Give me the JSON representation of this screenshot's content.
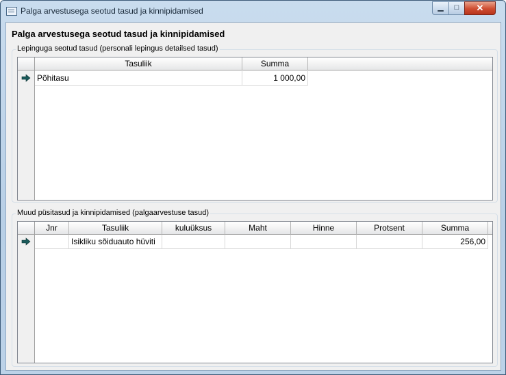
{
  "window": {
    "title": "Palga arvestusega seotud tasud ja kinnipidamised",
    "controls": {
      "minimize": "▁",
      "maximize": "□",
      "close": "✕"
    }
  },
  "heading": "Palga arvestusega seotud tasud ja kinnipidamised",
  "contract_group": {
    "label": "Lepinguga seotud tasud (personali lepingus detailsed tasud)",
    "columns": [
      "Tasuliik",
      "Summa"
    ],
    "rows": [
      {
        "tasuliik": "Põhitasu",
        "summa": "1 000,00"
      }
    ]
  },
  "other_group": {
    "label": "Muud püsitasud ja kinnipidamised (palgaarvestuse tasud)",
    "columns": [
      "Jnr",
      "Tasuliik",
      "kuluüksus",
      "Maht",
      "Hinne",
      "Protsent",
      "Summa"
    ],
    "rows": [
      {
        "jnr": "",
        "tasuliik": "Isikliku sõiduauto hüviti",
        "kuluuksus": "",
        "maht": "",
        "hinne": "",
        "protsent": "",
        "summa": "256,00"
      }
    ]
  },
  "colors": {
    "accent": "#1a5a5a",
    "titlebar": "#c9dcee",
    "close": "#cf4d31"
  },
  "icons": {
    "row_indicator": "arrow-right-icon",
    "window": "window-icon"
  }
}
